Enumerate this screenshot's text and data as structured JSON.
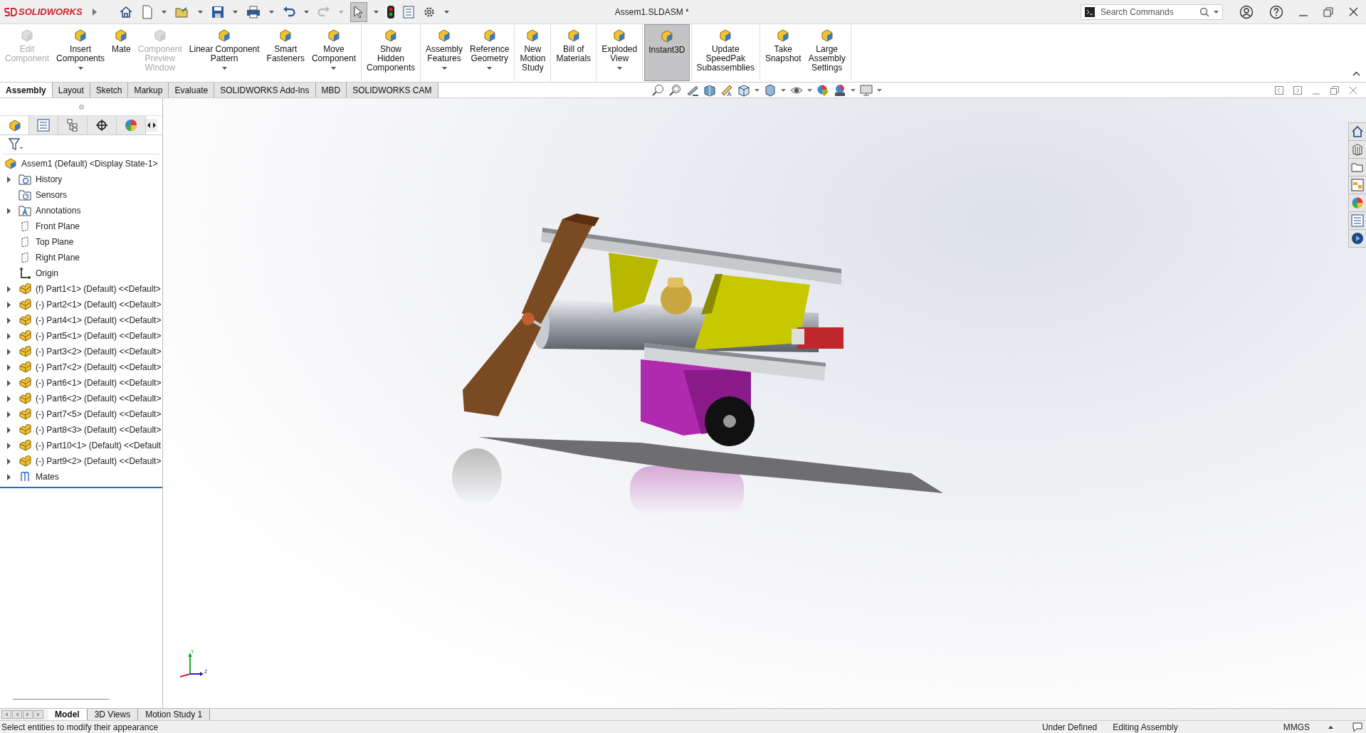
{
  "app": {
    "logo": "SOLIDWORKS"
  },
  "window": {
    "title": "Assem1.SLDASM *"
  },
  "search": {
    "placeholder": "Search Commands"
  },
  "ribbon_groups": [
    {
      "buttons": [
        {
          "label": "Edit\nComponent",
          "disabled": true,
          "dropdown": false,
          "selected": false
        },
        {
          "label": "Insert\nComponents",
          "disabled": false,
          "dropdown": true,
          "selected": false
        },
        {
          "label": "Mate",
          "disabled": false,
          "dropdown": false,
          "selected": false
        },
        {
          "label": "Component\nPreview\nWindow",
          "disabled": true,
          "dropdown": false,
          "selected": false
        },
        {
          "label": "Linear Component\nPattern",
          "disabled": false,
          "dropdown": true,
          "selected": false
        },
        {
          "label": "Smart\nFasteners",
          "disabled": false,
          "dropdown": false,
          "selected": false
        },
        {
          "label": "Move\nComponent",
          "disabled": false,
          "dropdown": true,
          "selected": false
        }
      ]
    },
    {
      "buttons": [
        {
          "label": "Show\nHidden\nComponents",
          "disabled": false,
          "dropdown": false,
          "selected": false
        }
      ]
    },
    {
      "buttons": [
        {
          "label": "Assembly\nFeatures",
          "disabled": false,
          "dropdown": true,
          "selected": false
        },
        {
          "label": "Reference\nGeometry",
          "disabled": false,
          "dropdown": true,
          "selected": false
        }
      ]
    },
    {
      "buttons": [
        {
          "label": "New\nMotion\nStudy",
          "disabled": false,
          "dropdown": false,
          "selected": false
        }
      ]
    },
    {
      "buttons": [
        {
          "label": "Bill of\nMaterials",
          "disabled": false,
          "dropdown": false,
          "selected": false
        }
      ]
    },
    {
      "buttons": [
        {
          "label": "Exploded\nView",
          "disabled": false,
          "dropdown": true,
          "selected": false
        }
      ]
    },
    {
      "buttons": [
        {
          "label": "Instant3D",
          "disabled": false,
          "dropdown": false,
          "selected": true
        }
      ]
    },
    {
      "buttons": [
        {
          "label": "Update\nSpeedPak\nSubassemblies",
          "disabled": false,
          "dropdown": false,
          "selected": false
        }
      ]
    },
    {
      "buttons": [
        {
          "label": "Take\nSnapshot",
          "disabled": false,
          "dropdown": false,
          "selected": false
        },
        {
          "label": "Large\nAssembly\nSettings",
          "disabled": false,
          "dropdown": false,
          "selected": false
        }
      ]
    }
  ],
  "command_tabs": [
    {
      "label": "Assembly",
      "selected": true
    },
    {
      "label": "Layout",
      "selected": false
    },
    {
      "label": "Sketch",
      "selected": false
    },
    {
      "label": "Markup",
      "selected": false
    },
    {
      "label": "Evaluate",
      "selected": false
    },
    {
      "label": "SOLIDWORKS Add-Ins",
      "selected": false
    },
    {
      "label": "MBD",
      "selected": false
    },
    {
      "label": "SOLIDWORKS CAM",
      "selected": false
    }
  ],
  "tree": {
    "root": "Assem1 (Default) <Display State-1>",
    "items": [
      {
        "label": "History",
        "kind": "history",
        "expandable": true
      },
      {
        "label": "Sensors",
        "kind": "sensors",
        "expandable": false
      },
      {
        "label": "Annotations",
        "kind": "annotations",
        "expandable": true
      },
      {
        "label": "Front Plane",
        "kind": "plane",
        "expandable": false
      },
      {
        "label": "Top Plane",
        "kind": "plane",
        "expandable": false
      },
      {
        "label": "Right Plane",
        "kind": "plane",
        "expandable": false
      },
      {
        "label": "Origin",
        "kind": "origin",
        "expandable": false
      },
      {
        "label": "(f) Part1<1> (Default) <<Default>",
        "kind": "part",
        "expandable": true
      },
      {
        "label": "(-) Part2<1> (Default) <<Default>",
        "kind": "part",
        "expandable": true
      },
      {
        "label": "(-) Part4<1> (Default) <<Default>",
        "kind": "part",
        "expandable": true
      },
      {
        "label": "(-) Part5<1> (Default) <<Default>",
        "kind": "part",
        "expandable": true
      },
      {
        "label": "(-) Part3<2> (Default) <<Default>",
        "kind": "part",
        "expandable": true
      },
      {
        "label": "(-) Part7<2> (Default) <<Default>",
        "kind": "part",
        "expandable": true
      },
      {
        "label": "(-) Part6<1> (Default) <<Default>",
        "kind": "part",
        "expandable": true
      },
      {
        "label": "(-) Part6<2> (Default) <<Default>",
        "kind": "part",
        "expandable": true
      },
      {
        "label": "(-) Part7<5> (Default) <<Default>",
        "kind": "part",
        "expandable": true
      },
      {
        "label": "(-) Part8<3> (Default) <<Default>",
        "kind": "part",
        "expandable": true
      },
      {
        "label": "(-) Part10<1> (Default) <<Default",
        "kind": "part",
        "expandable": true
      },
      {
        "label": "(-) Part9<2> (Default) <<Default>",
        "kind": "part",
        "expandable": true
      },
      {
        "label": "Mates",
        "kind": "mates",
        "expandable": true
      }
    ]
  },
  "triad_labels": [
    "Y",
    "Z"
  ],
  "bottom_tabs": [
    {
      "label": "Model",
      "selected": true
    },
    {
      "label": "3D Views",
      "selected": false
    },
    {
      "label": "Motion Study 1",
      "selected": false
    }
  ],
  "status_bar": {
    "message": "Select entities to modify their appearance",
    "items": [
      "Under Defined",
      "Editing Assembly",
      "MMGS"
    ]
  }
}
